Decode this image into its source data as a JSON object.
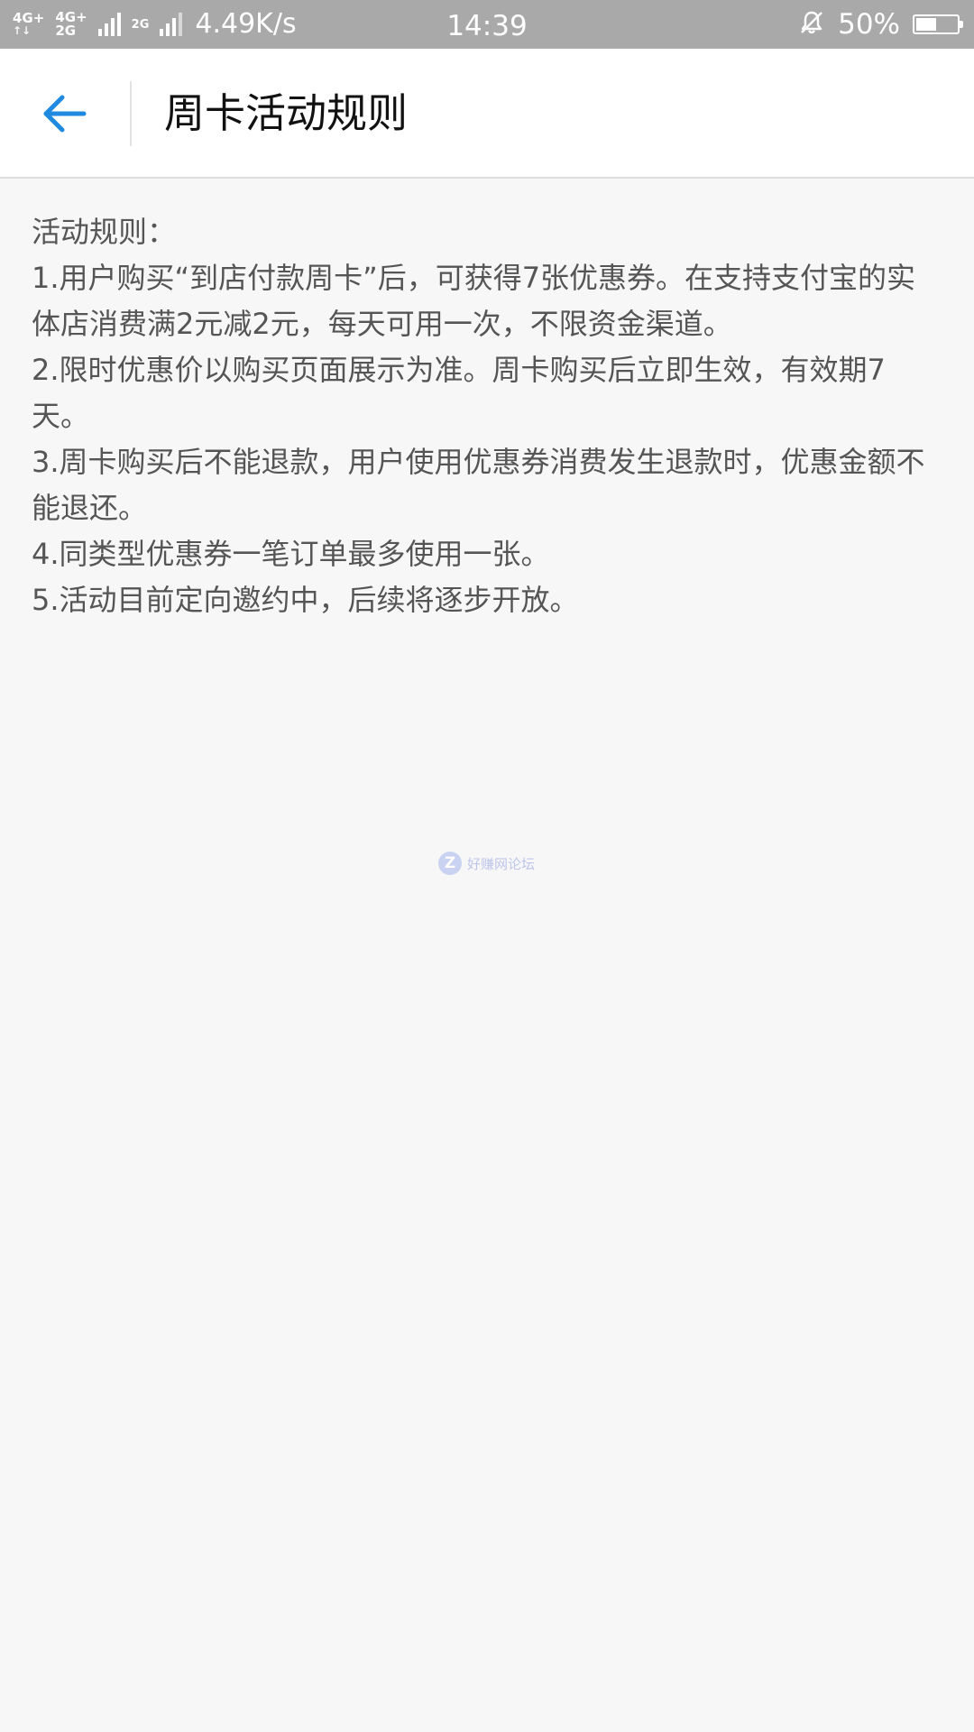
{
  "status_bar": {
    "network_primary": "4G+",
    "network_secondary_top": "4G+",
    "network_secondary_bottom": "2G",
    "network_tertiary": "2G",
    "net_speed": "4.49K/s",
    "time": "14:39",
    "battery_percent_text": "50%",
    "battery_level": 0.5,
    "icons": [
      "signal-icon",
      "bell-muted-icon",
      "battery-icon"
    ]
  },
  "app_bar": {
    "title": "周卡活动规则",
    "back_icon": "arrow-left-icon",
    "accent_color": "#1f8ae0"
  },
  "rules": {
    "heading": "活动规则：",
    "items": [
      "1.用户购买“到店付款周卡”后，可获得7张优惠券。在支持支付宝的实体店消费满2元减2元，每天可用一次，不限资金渠道。",
      "2.限时优惠价以购买页面展示为准。周卡购买后立即生效，有效期7天。",
      "3.周卡购买后不能退款，用户使用优惠券消费发生退款时，优惠金额不能退还。",
      "4.同类型优惠券一笔订单最多使用一张。",
      "5.活动目前定向邀约中，后续将逐步开放。"
    ]
  },
  "watermark": {
    "logo_letter": "Z",
    "text": "好赚网论坛"
  }
}
